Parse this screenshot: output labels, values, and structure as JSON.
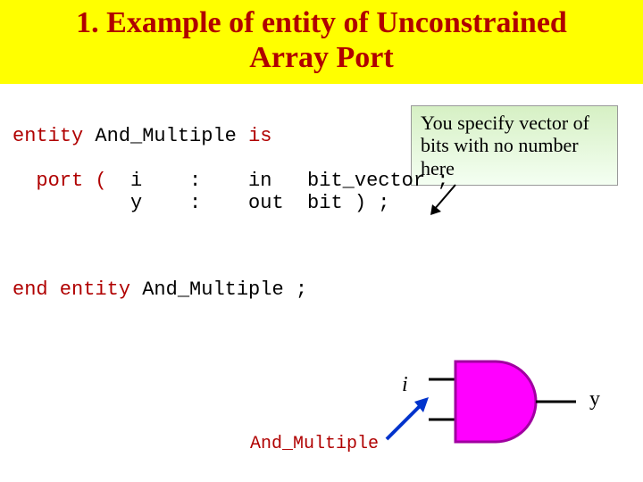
{
  "title": {
    "line1": "1. Example of entity of Unconstrained",
    "line2": "Array Port"
  },
  "callout": {
    "text": "You specify vector of bits with no number here"
  },
  "code": {
    "l1a": "entity",
    "l1b": " And_Multiple ",
    "l1c": "is",
    "l2a": "  port (",
    "l2b": "  i    :    in   bit_vector ;",
    "l3": "          y    :    out  bit ) ;",
    "l4a": "end entity",
    "l4b": " And_Multiple ;"
  },
  "diagram": {
    "input_label": "i",
    "output_label": "y",
    "gate_name": "And_Multiple"
  }
}
